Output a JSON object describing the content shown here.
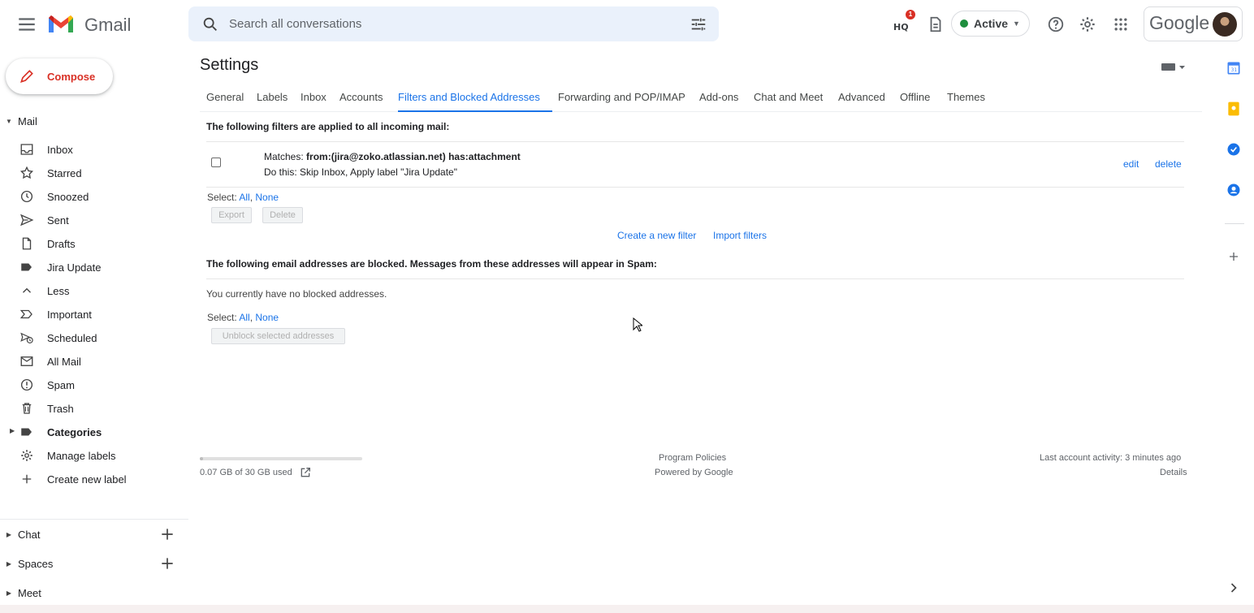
{
  "header": {
    "app_name": "Gmail",
    "search_placeholder": "Search all conversations",
    "hq_badge": "1",
    "status_label": "Active",
    "account_brand": "Google"
  },
  "sidebar": {
    "compose_label": "Compose",
    "mail_section": "Mail",
    "items": [
      {
        "label": "Inbox",
        "icon": "inbox-icon"
      },
      {
        "label": "Starred",
        "icon": "star-icon"
      },
      {
        "label": "Snoozed",
        "icon": "clock-icon"
      },
      {
        "label": "Sent",
        "icon": "send-icon"
      },
      {
        "label": "Drafts",
        "icon": "draft-icon"
      },
      {
        "label": "Jira Update",
        "icon": "label-icon"
      },
      {
        "label": "Less",
        "icon": "chevron-up-icon"
      },
      {
        "label": "Important",
        "icon": "important-icon"
      },
      {
        "label": "Scheduled",
        "icon": "scheduled-icon"
      },
      {
        "label": "All Mail",
        "icon": "all-mail-icon"
      },
      {
        "label": "Spam",
        "icon": "spam-icon"
      },
      {
        "label": "Trash",
        "icon": "trash-icon"
      },
      {
        "label": "Categories",
        "icon": "label-icon"
      },
      {
        "label": "Manage labels",
        "icon": "gear-icon"
      },
      {
        "label": "Create new label",
        "icon": "plus-icon"
      }
    ],
    "chat_section": "Chat",
    "spaces_section": "Spaces",
    "meet_section": "Meet"
  },
  "settings": {
    "title": "Settings",
    "tabs": [
      "General",
      "Labels",
      "Inbox",
      "Accounts",
      "Filters and Blocked Addresses",
      "Forwarding and POP/IMAP",
      "Add-ons",
      "Chat and Meet",
      "Advanced",
      "Offline",
      "Themes"
    ],
    "active_tab": "Filters and Blocked Addresses",
    "filters_heading": "The following filters are applied to all incoming mail:",
    "filter": {
      "matches_prefix": "Matches:",
      "matches_query": "from:(jira@zoko.atlassian.net) has:attachment",
      "action": "Do this: Skip Inbox, Apply label \"Jira Update\"",
      "edit_label": "edit",
      "delete_label": "delete"
    },
    "select_prefix": "Select:",
    "select_all": "All",
    "select_none": "None",
    "export_button": "Export",
    "delete_button": "Delete",
    "create_filter": "Create a new filter",
    "import_filters": "Import filters",
    "blocked_heading": "The following email addresses are blocked. Messages from these addresses will appear in Spam:",
    "no_blocked": "You currently have no blocked addresses.",
    "unblock_button": "Unblock selected addresses"
  },
  "footer": {
    "storage_used": "0.07 GB of 30 GB used",
    "storage_fraction": 0.0023,
    "program_policies": "Program Policies",
    "powered_by": "Powered by Google",
    "last_activity": "Last account activity: 3 minutes ago",
    "details": "Details"
  },
  "colors": {
    "accent": "#1a73e8",
    "compose_red": "#d93025",
    "active_green": "#1e8e3e"
  }
}
